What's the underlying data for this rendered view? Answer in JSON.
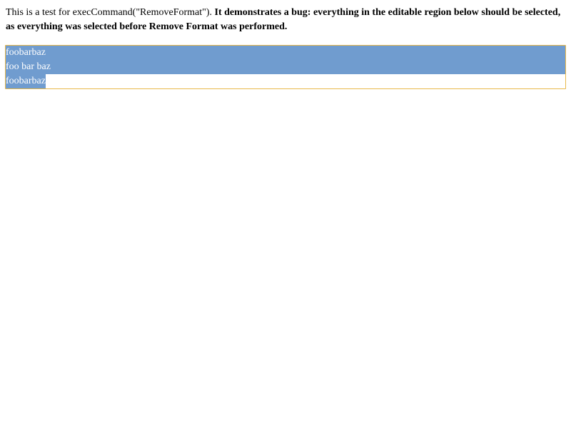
{
  "intro": {
    "plain_text": "This is a test for execCommand(\"RemoveFormat\"). ",
    "bold_text": "It demonstrates a bug: everything in the editable region below should be selected, as everything was selected before Remove Format was performed."
  },
  "editable_region": {
    "lines": [
      "foobarbaz",
      "foo bar baz",
      "foobarbaz"
    ]
  },
  "colors": {
    "selection": "#709ccf",
    "focus_border": "#e8b84a"
  }
}
